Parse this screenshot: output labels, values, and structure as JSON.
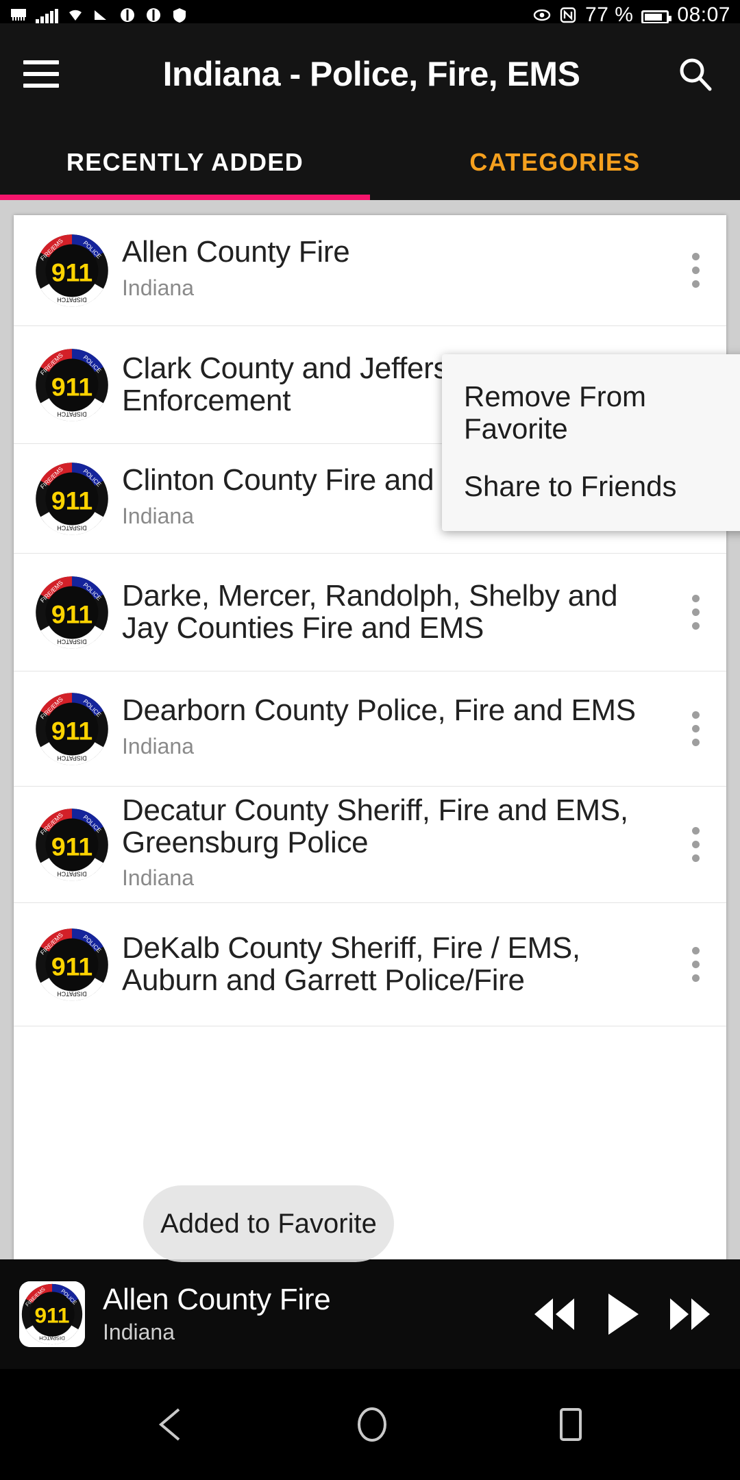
{
  "status_bar": {
    "battery_percent": "77 %",
    "time": "08:07",
    "icons": [
      "wifi-calling-icon",
      "signal-bars-icon",
      "wifi-icon",
      "cast-icon",
      "sync-icon",
      "sync-icon-2",
      "shield-icon",
      "eye-icon",
      "nfc-icon",
      "battery-icon"
    ]
  },
  "appbar": {
    "menu_icon": "hamburger-menu-icon",
    "title": "Indiana - Police, Fire, EMS",
    "search_icon": "search-icon"
  },
  "tabs": [
    {
      "label": "RECENTLY ADDED",
      "active": true
    },
    {
      "label": "CATEGORIES",
      "active": false
    }
  ],
  "colors": {
    "tab_active_underline": "#f5156c",
    "tab_inactive_text": "#f5a01e",
    "appbar_bg": "#141414",
    "list_bg": "#ffffff",
    "page_bg": "#cfcfcf"
  },
  "list": {
    "rows": [
      {
        "title": "Allen County Fire",
        "subtitle": "Indiana"
      },
      {
        "title": "Clark County and Jeffersonville Law Enforcement",
        "subtitle": ""
      },
      {
        "title": "Clinton County Fire and EMS",
        "subtitle": "Indiana"
      },
      {
        "title": "Darke, Mercer, Randolph, Shelby and Jay Counties Fire and EMS",
        "subtitle": ""
      },
      {
        "title": "Dearborn County Police, Fire and EMS",
        "subtitle": "Indiana"
      },
      {
        "title": "Decatur County Sheriff, Fire and EMS, Greensburg Police",
        "subtitle": "Indiana"
      },
      {
        "title": "DeKalb County Sheriff, Fire / EMS, Auburn and Garrett Police/Fire",
        "subtitle": ""
      }
    ]
  },
  "popup_menu": {
    "items": [
      {
        "label": "Remove From Favorite"
      },
      {
        "label": "Share to Friends"
      }
    ]
  },
  "toast": {
    "message": "Added to Favorite"
  },
  "player": {
    "title": "Allen County Fire",
    "subtitle": "Indiana",
    "controls": [
      {
        "name": "rewind-button"
      },
      {
        "name": "play-button"
      },
      {
        "name": "fast-forward-button"
      }
    ]
  },
  "nav_bar": {
    "back": "back-button",
    "home": "home-button",
    "recents": "recents-button"
  }
}
